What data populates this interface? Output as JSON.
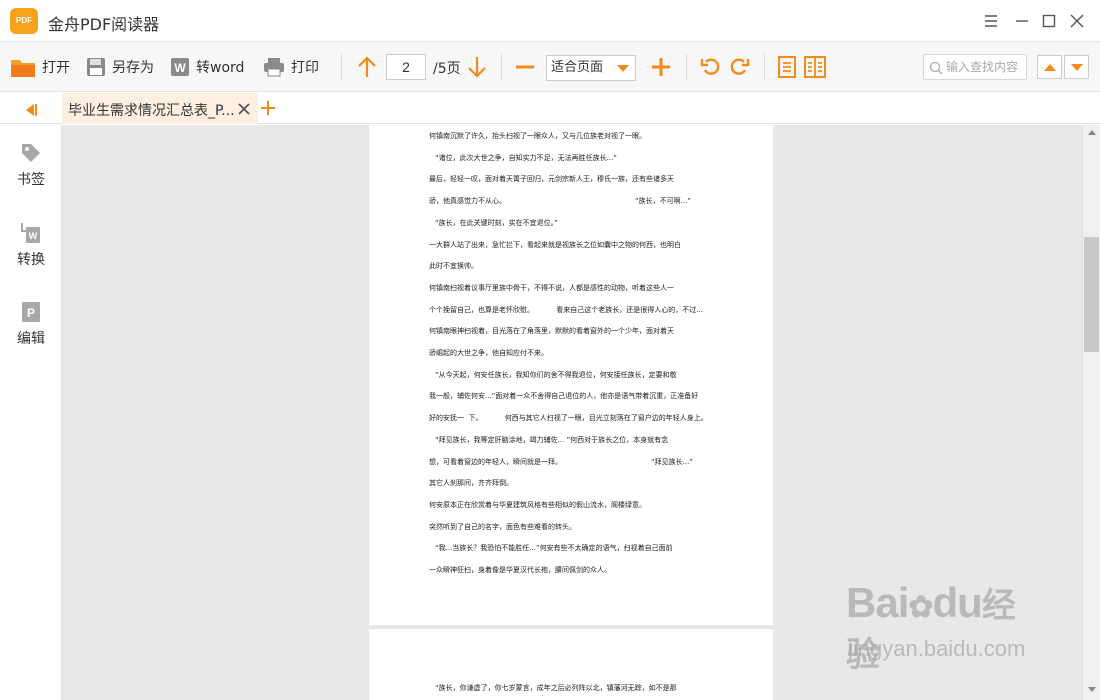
{
  "app": {
    "logo_text": "PDF",
    "title": "金舟PDF阅读器"
  },
  "toolbar": {
    "open_label": "打开",
    "save_as_label": "另存为",
    "to_word_label": "转word",
    "print_label": "打印",
    "current_page": "2",
    "total_pages": "/5页",
    "zoom_value": "适合页面",
    "search_placeholder": "输入查找内容"
  },
  "tabs": [
    {
      "label": "毕业生需求情况汇总表_P..."
    }
  ],
  "sidebar": {
    "items": [
      {
        "label": "书签",
        "icon": "tag-icon"
      },
      {
        "label": "转换",
        "icon": "convert-word-icon"
      },
      {
        "label": "编辑",
        "icon": "edit-pdf-icon"
      }
    ]
  },
  "document": {
    "page1_lines": [
      "何镇南沉默了许久，抬头扫视了一眼众人，又与几位族老对视了一眼。",
      "“诸位，此次大世之争，自知实力不足，无法再胜任族长...”",
      "最后，轻轻一叹，面对着天箐子回归，元剑宗新人王，穆氏一族，还有些诸多天",
      "骄，他真感觉力不从心。                                                          “族长，不可啊...”",
      "“族长，在此关键时刻，实在不宜退位。”",
      "一大群人站了出来，急忙拦下，看起来就是视族长之位如囊中之物的何西，也明白",
      "此时不宜换帅。",
      "何镇南扫视着议事厅里族中骨干，不得不说，人都是感性的动物，听着这些人一",
      "个个挽留自己，也算是老怀欣慰。          看来自己这个老族长，还是很得人心的，不过...",
      "何镇南眼神扫视着，目光落在了角落里，默默的看着窗外的一个少年，面对着天",
      "骄崛起的大世之争，他自知应付不来。",
      "“从今天起，何安任族长，我知你们的舍不得我退位，何安接任族长，定要和敬",
      "我一般，辅佐何安...”面对着一众不舍得自己退位的人，他亦是语气带着沉重，正准备好",
      "好的安抚一  下。          何西与其它人扫视了一眼，目光立刻落在了窗户边的年轻人身上。",
      "“拜见族长，我等定肝脑涂地，竭力辅佐... ”何西对于族长之位，本身就有念",
      "想，可看着窗边的年轻人，瞬间就是一拜。                                        “拜见族长...”",
      "其它人刹那间，齐齐拜倒。",
      "何安原本正在欣赏着与华夏建筑风格有些相似的假山流水，阁楼绿意。",
      "突然听到了自己的名字，面色有些难看的转头。",
      "“我...当族长？我恐怕不能胜任...”何安有些不太确定的语气，扫视着自己面前",
      "一众瞬神狂扫，身着像是华夏汉代长袍，腰间佩剑的众人。"
    ],
    "page2_lines": [
      "“族长，你谦虚了，你七岁蒙言，成年之后必列阵以北，镇藩河无踪，如不是那"
    ]
  },
  "watermark": {
    "brand": "Bai",
    "brand_suffix": "du",
    "brand_cn": "经验",
    "url": "jingyan.baidu.com"
  },
  "colors": {
    "accent_orange": "#f28b1c",
    "tab_bg": "#fdf0e2",
    "doc_bg": "#e8e8e8"
  }
}
